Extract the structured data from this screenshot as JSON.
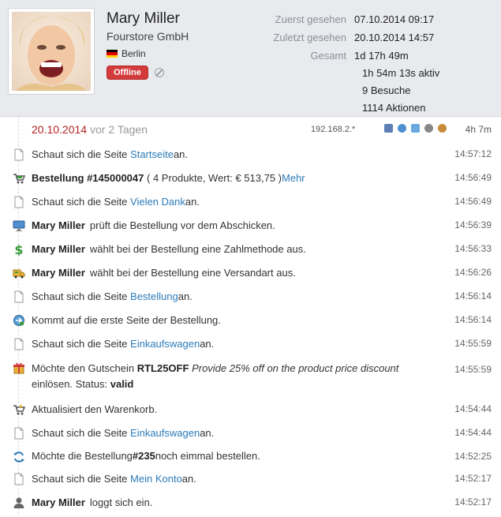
{
  "profile": {
    "name": "Mary Miller",
    "company": "Fourstore GmbH",
    "location": "Berlin",
    "status": "Offline"
  },
  "stats": [
    {
      "label": "Zuerst gesehen",
      "value": "07.10.2014 09:17"
    },
    {
      "label": "Zuletzt gesehen",
      "value": "20.10.2014 14:57"
    },
    {
      "label": "Gesamt",
      "value": "1d 17h 49m"
    }
  ],
  "stats_extra": [
    "1h 54m 13s aktiv",
    "9 Besuche",
    "1114 Aktionen"
  ],
  "session": {
    "date": "20.10.2014",
    "ago": "vor 2 Tagen",
    "ip": "192.168.2.*",
    "duration": "4h 7m"
  },
  "events": [
    {
      "icon": "page-icon",
      "time": "14:57:12",
      "t1": "Schaut sich die Seite ",
      "link": "Startseite",
      "t2": " an."
    },
    {
      "icon": "cart-order-icon",
      "time": "14:56:49",
      "bold": "Bestellung #145000047",
      "t1": " ( 4 Produkte, Wert: € 513,75 ) ",
      "link": "Mehr"
    },
    {
      "icon": "page-icon",
      "time": "14:56:49",
      "t1": "Schaut sich die Seite ",
      "link": "Vielen Dank",
      "t2": " an."
    },
    {
      "icon": "monitor-icon",
      "time": "14:56:39",
      "bold": "Mary Miller",
      "t1": "prüft die Bestellung vor dem Abschicken."
    },
    {
      "icon": "dollar-icon",
      "time": "14:56:33",
      "bold": "Mary Miller",
      "t1": "wählt bei der Bestellung eine Zahlmethode aus."
    },
    {
      "icon": "truck-icon",
      "time": "14:56:26",
      "bold": "Mary Miller",
      "t1": "wählt bei der Bestellung eine Versandart aus."
    },
    {
      "icon": "page-icon",
      "time": "14:56:14",
      "t1": "Schaut sich die Seite ",
      "link": "Bestellung",
      "t2": " an."
    },
    {
      "icon": "checkout-icon",
      "time": "14:56:14",
      "t1": "Kommt auf die erste Seite der Bestellung."
    },
    {
      "icon": "page-icon",
      "time": "14:55:59",
      "t1": "Schaut sich die Seite ",
      "link": "Einkaufswagen",
      "t2": " an."
    },
    {
      "icon": "gift-icon",
      "time": "14:55:59",
      "t1": "Möchte den Gutschein ",
      "bold2": "RTL25OFF",
      "italic": "Provide 25% off on the product price discount",
      "t3": "einlösen. Status: ",
      "bold3": "valid"
    },
    {
      "icon": "cart-update-icon",
      "time": "14:54:44",
      "t1": "Aktualisiert den Warenkorb."
    },
    {
      "icon": "page-icon",
      "time": "14:54:44",
      "t1": "Schaut sich die Seite ",
      "link": "Einkaufswagen",
      "t2": " an."
    },
    {
      "icon": "reorder-icon",
      "time": "14:52:25",
      "t1": "Möchte die Bestellung ",
      "bold2": "#235",
      "t2": " noch eimmal bestellen."
    },
    {
      "icon": "page-icon",
      "time": "14:52:17",
      "t1": "Schaut sich die Seite ",
      "link": "Mein Konto",
      "t2": " an."
    },
    {
      "icon": "user-icon",
      "time": "14:52:17",
      "bold": "Mary Miller",
      "t1": "loggt sich ein."
    }
  ]
}
